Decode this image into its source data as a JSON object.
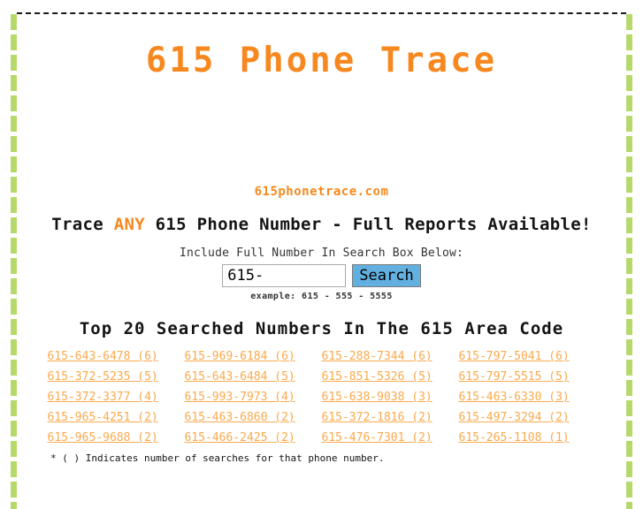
{
  "page": {
    "title": "615 Phone Trace",
    "domain_line": "615phonetrace.com",
    "accent_orange": "#f7881f",
    "link_orange": "#fba94c",
    "rail_green": "#b5d96a",
    "button_blue": "#62b0e0"
  },
  "tagline": {
    "before": "Trace ",
    "highlight": "ANY",
    "after": " 615 Phone Number - Full Reports Available!"
  },
  "search": {
    "label": "Include Full Number In Search Box Below:",
    "value": "615-",
    "placeholder": "615-",
    "button_label": "Search",
    "example": "example: 615 - 555 - 5555"
  },
  "top_numbers": {
    "heading": "Top 20 Searched Numbers In The 615 Area Code",
    "footnote": "* ( ) Indicates number of searches for that phone number.",
    "items": [
      "615-643-6478 (6)",
      "615-969-6184 (6)",
      "615-288-7344 (6)",
      "615-797-5041 (6)",
      "615-372-5235 (5)",
      "615-643-6484 (5)",
      "615-851-5326 (5)",
      "615-797-5515 (5)",
      "615-372-3377 (4)",
      "615-993-7973 (4)",
      "615-638-9038 (3)",
      "615-463-6330 (3)",
      "615-965-4251 (2)",
      "615-463-6860 (2)",
      "615-372-1816 (2)",
      "615-497-3294 (2)",
      "615-965-9688 (2)",
      "615-466-2425 (2)",
      "615-476-7301 (2)",
      "615-265-1108 (1)"
    ]
  }
}
